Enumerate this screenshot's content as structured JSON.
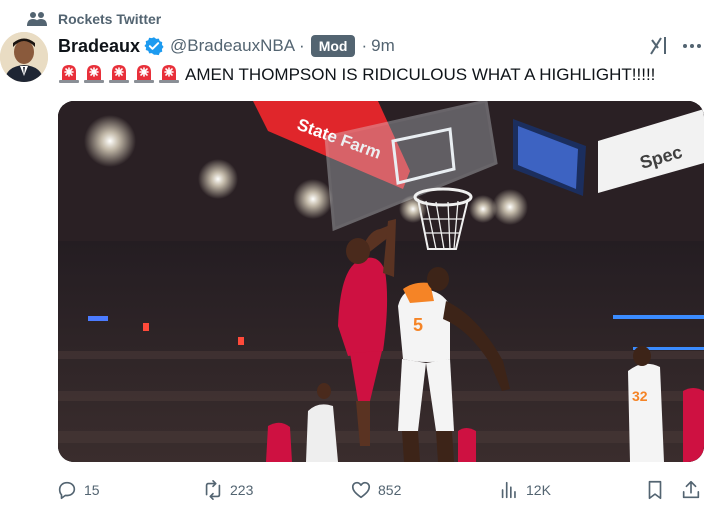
{
  "community": {
    "name": "Rockets Twitter",
    "icon": "community-icon"
  },
  "author": {
    "display_name": "Bradeaux",
    "handle": "@BradeauxNBA",
    "badge": "Mod",
    "separator": "·",
    "time": "9m",
    "verified_icon": "verified-badge-icon"
  },
  "tweet": {
    "emoji_count": 5,
    "emoji_icon": "rotating-light-emoji",
    "text": "AMEN THOMPSON IS RIDICULOUS WHAT A HIGHLIGHT!!!!!"
  },
  "media": {
    "type": "video-still",
    "banner_text": "State Farm",
    "scoreboard_text": "Spec"
  },
  "actions": {
    "replies": "15",
    "reposts": "223",
    "likes": "852",
    "views": "12K"
  },
  "colors": {
    "text_primary": "#0f1419",
    "text_secondary": "#536471",
    "verified": "#1d9bf0",
    "mod_badge_bg": "#536471",
    "rockets_red": "#ce1141",
    "knicks_orange": "#f58426"
  }
}
